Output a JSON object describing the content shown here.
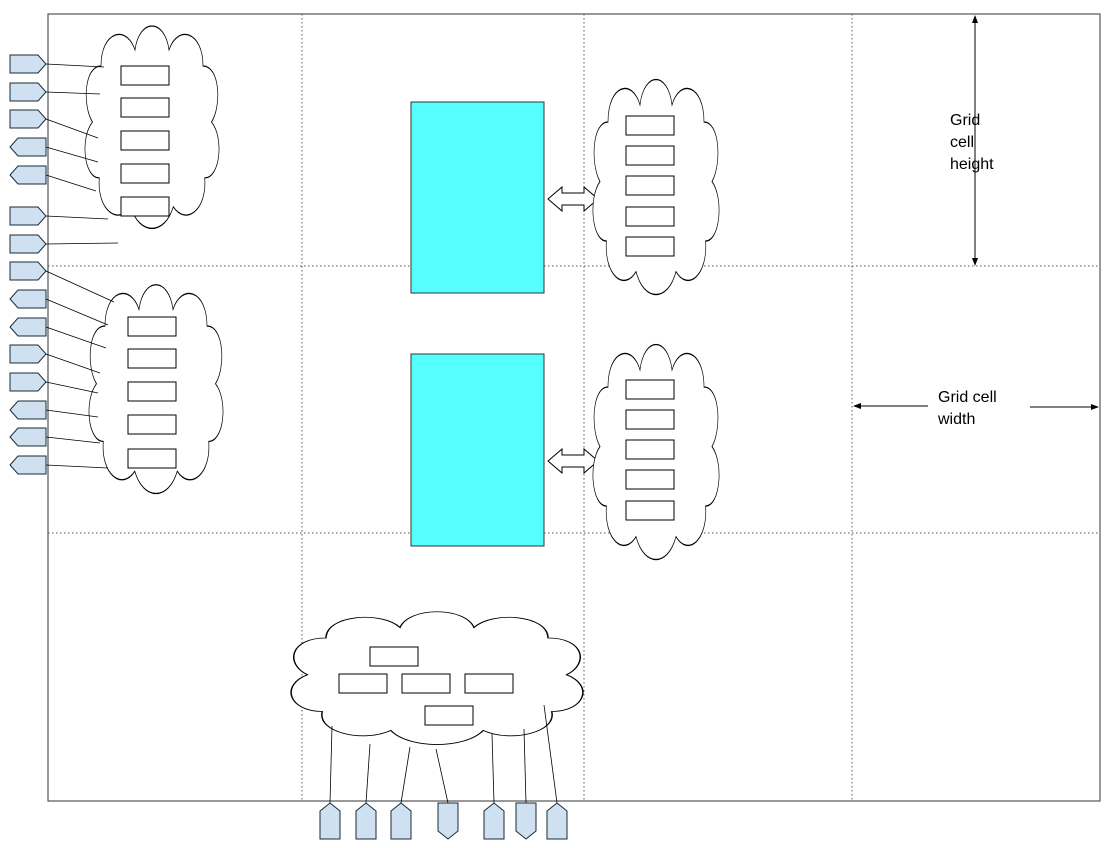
{
  "annotations": {
    "cell_height_line1": "Grid",
    "cell_height_line2": "cell",
    "cell_height_line3": "height",
    "cell_width_line1": "Grid cell",
    "cell_width_line2": "width"
  },
  "colors": {
    "macro_fill": "#55FFFF",
    "pin_fill": "#CFE0F0",
    "pin_stroke": "#1A2A3A",
    "grid_line": "#555555",
    "outline": "#000000"
  },
  "grid": {
    "rows": 3,
    "columns": 4
  }
}
